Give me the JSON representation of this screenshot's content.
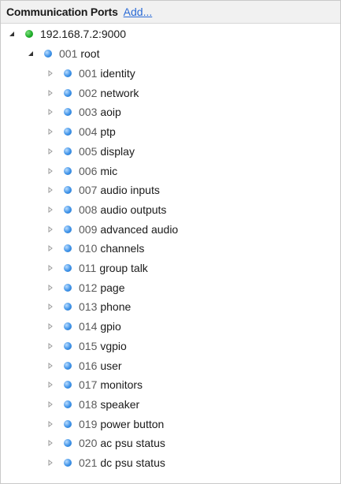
{
  "header": {
    "title": "Communication Ports",
    "add_link": "Add..."
  },
  "tree": {
    "host": {
      "label": "192.168.7.2:9000",
      "status_color": "#1fae2a",
      "expanded": true
    },
    "root": {
      "num": "001",
      "name": "root",
      "status_color": "#3f93e8",
      "expanded": true
    },
    "children": [
      {
        "num": "001",
        "name": "identity"
      },
      {
        "num": "002",
        "name": "network"
      },
      {
        "num": "003",
        "name": "aoip"
      },
      {
        "num": "004",
        "name": "ptp"
      },
      {
        "num": "005",
        "name": "display"
      },
      {
        "num": "006",
        "name": "mic"
      },
      {
        "num": "007",
        "name": "audio inputs"
      },
      {
        "num": "008",
        "name": "audio outputs"
      },
      {
        "num": "009",
        "name": "advanced audio"
      },
      {
        "num": "010",
        "name": "channels"
      },
      {
        "num": "011",
        "name": "group talk"
      },
      {
        "num": "012",
        "name": "page"
      },
      {
        "num": "013",
        "name": "phone"
      },
      {
        "num": "014",
        "name": "gpio"
      },
      {
        "num": "015",
        "name": "vgpio"
      },
      {
        "num": "016",
        "name": "user"
      },
      {
        "num": "017",
        "name": "monitors"
      },
      {
        "num": "018",
        "name": "speaker"
      },
      {
        "num": "019",
        "name": "power button"
      },
      {
        "num": "020",
        "name": "ac psu status"
      },
      {
        "num": "021",
        "name": "dc psu status"
      }
    ]
  }
}
